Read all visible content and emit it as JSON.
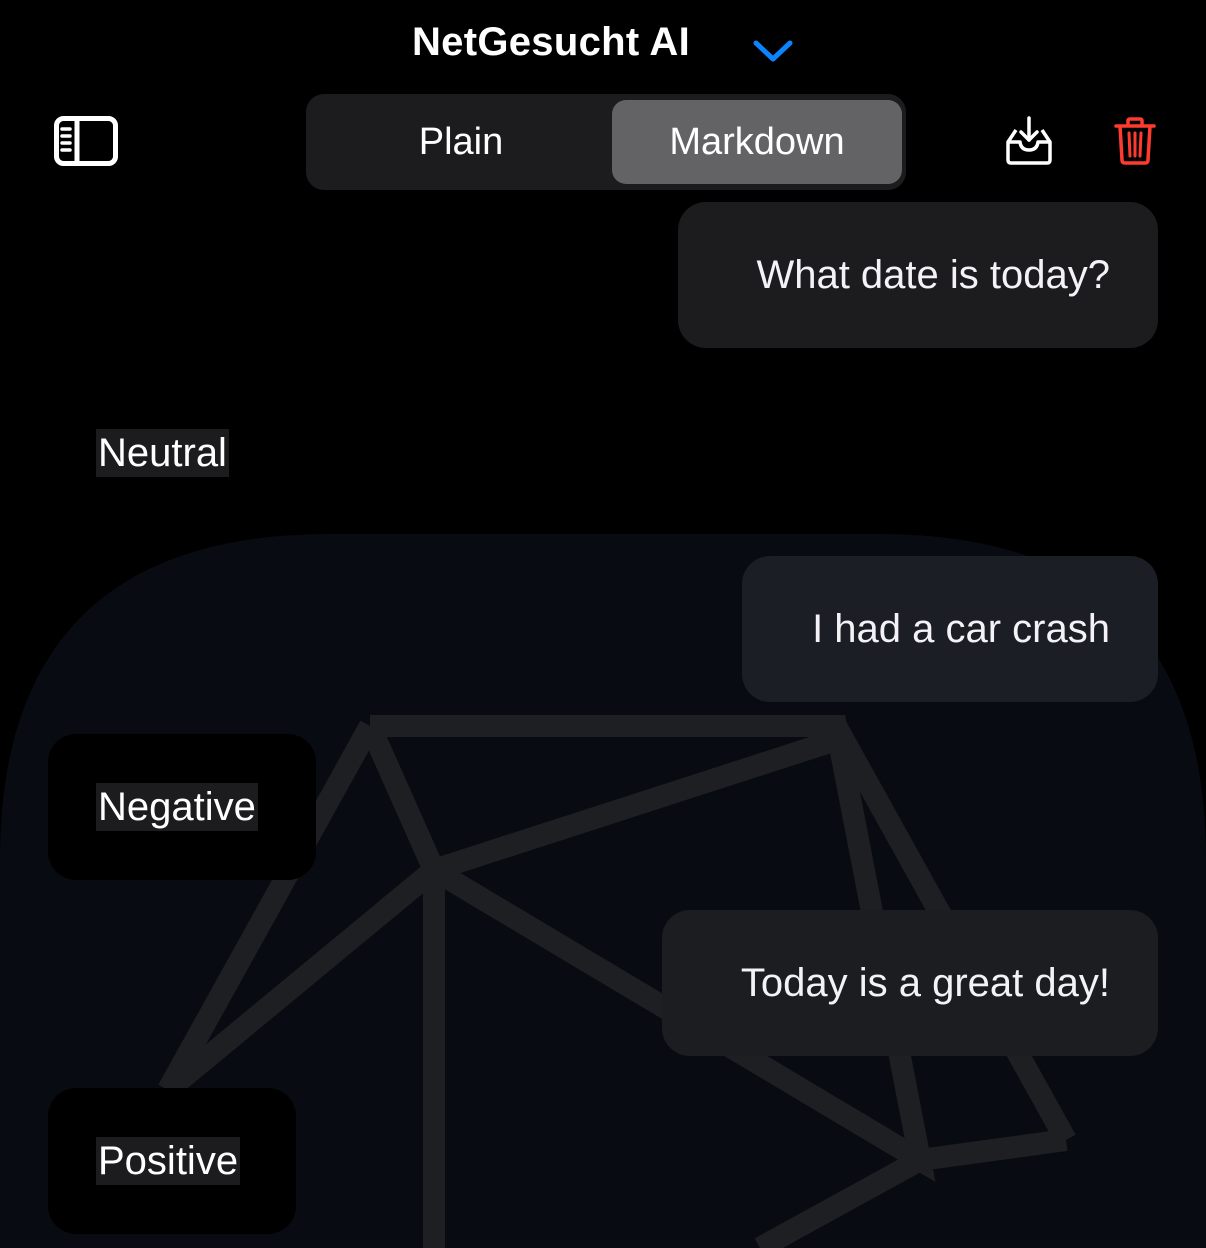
{
  "header": {
    "title": "NetGesucht AI",
    "chevron_icon": "chevron-down-icon",
    "accent_color": "#0a84ff"
  },
  "toolbar": {
    "sidebar_icon": "sidebar-toggle-icon",
    "segments": [
      {
        "label": "Plain",
        "selected": false
      },
      {
        "label": "Markdown",
        "selected": true
      }
    ],
    "download_icon": "inbox-download-icon",
    "delete_icon": "trash-icon",
    "delete_color": "#ff3b30"
  },
  "messages": [
    {
      "role": "user",
      "text": "What date is today?"
    },
    {
      "role": "assistant",
      "text": "Neutral"
    },
    {
      "role": "user",
      "text": "I had a car crash"
    },
    {
      "role": "assistant",
      "text": "Negative"
    },
    {
      "role": "user",
      "text": "Today is a great day!"
    },
    {
      "role": "assistant",
      "text": "Positive"
    }
  ]
}
